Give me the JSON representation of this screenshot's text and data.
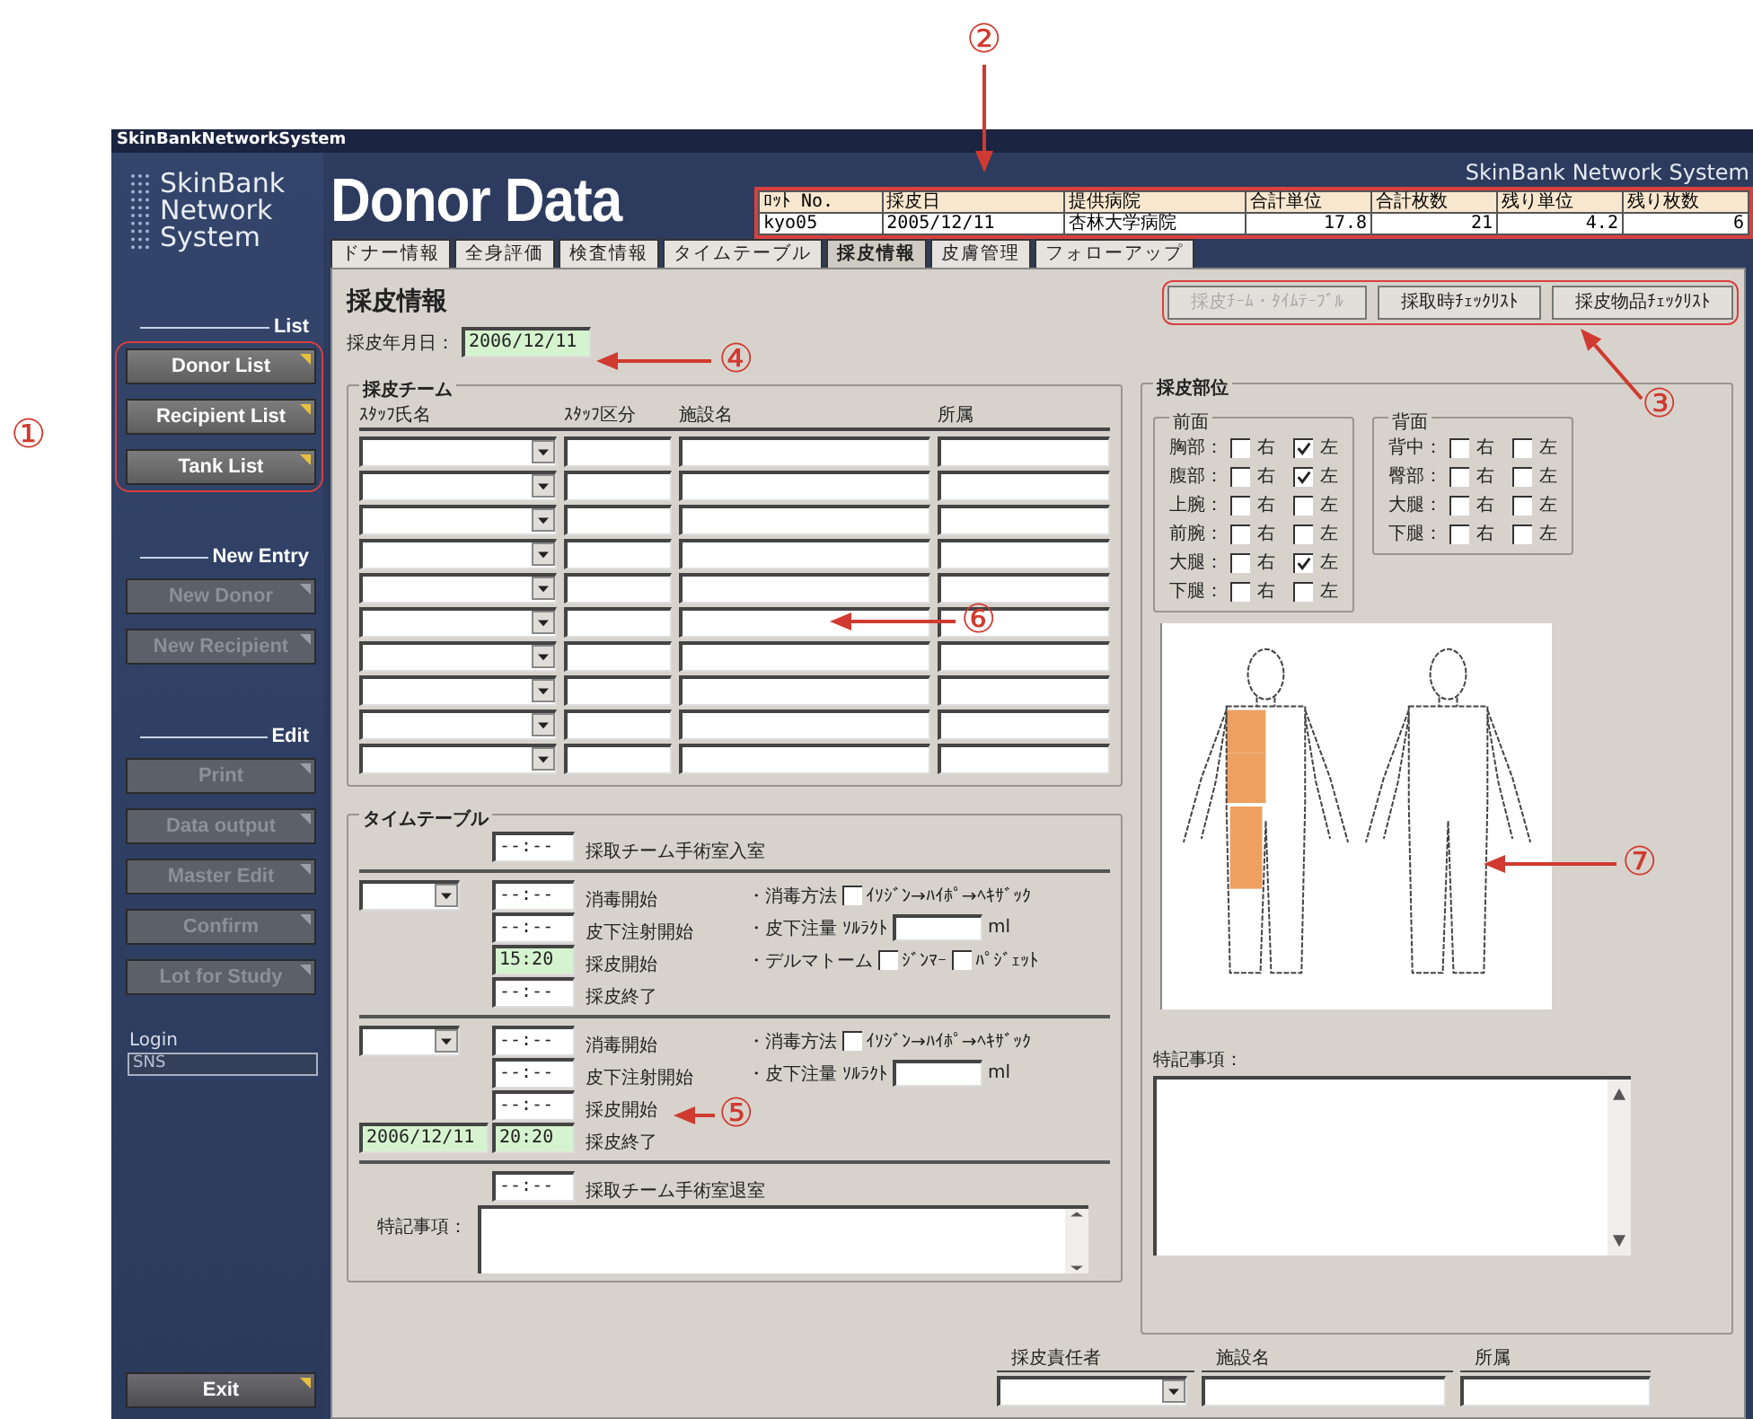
{
  "title_bar": {
    "title": "SkinBankNetworkSystem"
  },
  "sidebar": {
    "logo": [
      "SkinBank",
      "Network",
      "System"
    ],
    "sections": [
      {
        "heading": "List",
        "buttons": [
          {
            "label": "Donor List",
            "disabled": false
          },
          {
            "label": "Recipient List",
            "disabled": false
          },
          {
            "label": "Tank List",
            "disabled": false
          }
        ]
      },
      {
        "heading": "New Entry",
        "buttons": [
          {
            "label": "New Donor",
            "disabled": true
          },
          {
            "label": "New Recipient",
            "disabled": true
          }
        ]
      },
      {
        "heading": "Edit",
        "buttons": [
          {
            "label": "Print",
            "disabled": true
          },
          {
            "label": "Data output",
            "disabled": true
          },
          {
            "label": "Master Edit",
            "disabled": true
          },
          {
            "label": "Confirm",
            "disabled": true
          },
          {
            "label": "Lot for Study",
            "disabled": true
          }
        ]
      }
    ],
    "login": {
      "label": "Login",
      "value": "SNS"
    },
    "exit": "Exit"
  },
  "header": {
    "brand": "SkinBank Network System",
    "title": "Donor Data",
    "lot_table": {
      "columns": [
        "ﾛｯﾄ No.",
        "採皮日",
        "提供病院",
        "合計単位",
        "合計枚数",
        "残り単位",
        "残り枚数"
      ],
      "row": [
        "kyo05",
        "2005/12/11",
        "杏林大学病院",
        "17.8",
        "21",
        "4.2",
        "6"
      ]
    }
  },
  "tabs": [
    {
      "label": "ドナー情報",
      "selected": false
    },
    {
      "label": "全身評価",
      "selected": false
    },
    {
      "label": "検査情報",
      "selected": false
    },
    {
      "label": "タイムテーブル",
      "selected": false
    },
    {
      "label": "採皮情報",
      "selected": true
    },
    {
      "label": "皮膚管理",
      "selected": false
    },
    {
      "label": "フォローアップ",
      "selected": false
    }
  ],
  "panel": {
    "heading": "採皮情報",
    "buttons": [
      {
        "label": "採皮ﾁｰﾑ・ﾀｲﾑﾃｰﾌﾞﾙ",
        "disabled": true
      },
      {
        "label": "採取時ﾁｪｯｸﾘｽﾄ",
        "disabled": false
      },
      {
        "label": "採皮物品ﾁｪｯｸﾘｽﾄ",
        "disabled": false
      }
    ],
    "date": {
      "label": "採皮年月日：",
      "value": "2006/12/11",
      "highlighted": true
    },
    "team": {
      "title": "採皮チーム",
      "columns": [
        "ｽﾀｯﾌ氏名",
        "ｽﾀｯﾌ区分",
        "施設名",
        "所属"
      ],
      "rows": [
        {
          "kind": "empty"
        },
        {
          "kind": "empty"
        },
        {
          "kind": "empty"
        },
        {
          "kind": "empty"
        },
        {
          "kind": "empty"
        },
        {
          "kind": "empty"
        },
        {
          "kind": "empty"
        },
        {
          "kind": "empty"
        },
        {
          "kind": "empty"
        },
        {
          "kind": "empty"
        }
      ]
    },
    "timetable": {
      "title": "タイムテーブル",
      "entry": {
        "time": "--:--",
        "label": "採取チーム手術室入室",
        "highlighted": false
      },
      "blocks": [
        {
          "steps": [
            {
              "time": "--:--",
              "label": "消毒開始",
              "highlighted": false
            },
            {
              "time": "--:--",
              "label": "皮下注射開始",
              "highlighted": false
            },
            {
              "time": "15:20",
              "label": "採皮開始",
              "highlighted": true
            },
            {
              "time": "--:--",
              "label": "採皮終了",
              "highlighted": false
            }
          ],
          "methods": [
            {
              "kind": "check",
              "label": "・消毒方法",
              "options": [
                {
                  "label": "ｲｿｼﾞﾝ→ﾊｲﾎﾟ→ﾍｷｻﾞｯｸ",
                  "checked": false
                }
              ]
            },
            {
              "kind": "amount",
              "label": "・皮下注量",
              "drug": "ｿﾙﾗｸﾄ",
              "unit": "ml"
            },
            {
              "kind": "check",
              "label": "・デルマトーム",
              "options": [
                {
                  "label": "ｼﾞﾝﾏｰ",
                  "checked": false
                },
                {
                  "label": "ﾊﾟｼﾞｪｯﾄ",
                  "checked": false
                }
              ]
            }
          ]
        },
        {
          "date": {
            "value": "2006/12/11",
            "highlighted": true
          },
          "steps": [
            {
              "time": "--:--",
              "label": "消毒開始",
              "highlighted": false
            },
            {
              "time": "--:--",
              "label": "皮下注射開始",
              "highlighted": false
            },
            {
              "time": "--:--",
              "label": "採皮開始",
              "highlighted": false
            },
            {
              "time": "20:20",
              "label": "採皮終了",
              "highlighted": true
            }
          ],
          "methods": [
            {
              "kind": "check",
              "label": "・消毒方法",
              "options": [
                {
                  "label": "ｲｿｼﾞﾝ→ﾊｲﾎﾟ→ﾍｷｻﾞｯｸ",
                  "checked": false
                }
              ]
            },
            {
              "kind": "amount",
              "label": "・皮下注量",
              "drug": "ｿﾙﾗｸﾄ",
              "unit": "ml"
            }
          ]
        }
      ],
      "exit_entry": {
        "time": "--:--",
        "label": "採取チーム手術室退室",
        "highlighted": false
      },
      "notes_label": "特記事項："
    },
    "site": {
      "title": "採皮部位",
      "groups": [
        {
          "title": "前面",
          "kind": "front",
          "rows": [
            {
              "part": "胸部：",
              "right": {
                "label": "右",
                "checked": false
              },
              "left": {
                "label": "左",
                "checked": true
              }
            },
            {
              "part": "腹部：",
              "right": {
                "label": "右",
                "checked": false
              },
              "left": {
                "label": "左",
                "checked": true
              }
            },
            {
              "part": "上腕：",
              "right": {
                "label": "右",
                "checked": false
              },
              "left": {
                "label": "左",
                "checked": false
              }
            },
            {
              "part": "前腕：",
              "right": {
                "label": "右",
                "checked": false
              },
              "left": {
                "label": "左",
                "checked": false
              }
            },
            {
              "part": "大腿：",
              "right": {
                "label": "右",
                "checked": false
              },
              "left": {
                "label": "左",
                "checked": true
              }
            },
            {
              "part": "下腿：",
              "right": {
                "label": "右",
                "checked": false
              },
              "left": {
                "label": "左",
                "checked": false
              }
            }
          ]
        },
        {
          "title": "背面",
          "kind": "back",
          "rows": [
            {
              "part": "背中：",
              "right": {
                "label": "右",
                "checked": false
              },
              "left": {
                "label": "左",
                "checked": false
              }
            },
            {
              "part": "臀部：",
              "right": {
                "label": "右",
                "checked": false
              },
              "left": {
                "label": "左",
                "checked": false
              }
            },
            {
              "part": "大腿：",
              "right": {
                "label": "右",
                "checked": false
              },
              "left": {
                "label": "左",
                "checked": false
              }
            },
            {
              "part": "下腿：",
              "right": {
                "label": "右",
                "checked": false
              },
              "left": {
                "label": "左",
                "checked": false
              }
            }
          ]
        }
      ],
      "notes_label": "特記事項："
    },
    "responsible": [
      {
        "kind": "select",
        "label": "採皮責任者"
      },
      {
        "kind": "text",
        "label": "施設名"
      },
      {
        "kind": "text",
        "label": "所属"
      }
    ]
  },
  "callouts": [
    "①",
    "②",
    "③",
    "④",
    "⑤",
    "⑥",
    "⑦"
  ]
}
